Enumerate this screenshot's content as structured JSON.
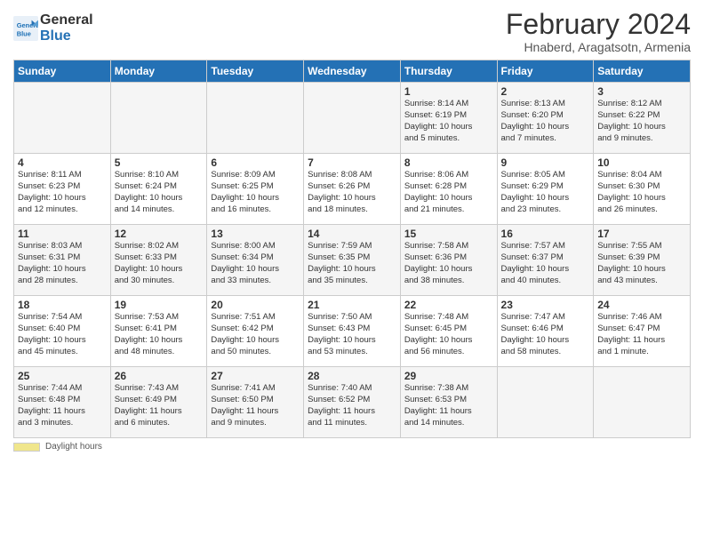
{
  "header": {
    "logo_line1": "General",
    "logo_line2": "Blue",
    "title": "February 2024",
    "subtitle": "Hnaberd, Aragatsotn, Armenia"
  },
  "days_of_week": [
    "Sunday",
    "Monday",
    "Tuesday",
    "Wednesday",
    "Thursday",
    "Friday",
    "Saturday"
  ],
  "weeks": [
    [
      {
        "day": "",
        "info": ""
      },
      {
        "day": "",
        "info": ""
      },
      {
        "day": "",
        "info": ""
      },
      {
        "day": "",
        "info": ""
      },
      {
        "day": "1",
        "info": "Sunrise: 8:14 AM\nSunset: 6:19 PM\nDaylight: 10 hours\nand 5 minutes."
      },
      {
        "day": "2",
        "info": "Sunrise: 8:13 AM\nSunset: 6:20 PM\nDaylight: 10 hours\nand 7 minutes."
      },
      {
        "day": "3",
        "info": "Sunrise: 8:12 AM\nSunset: 6:22 PM\nDaylight: 10 hours\nand 9 minutes."
      }
    ],
    [
      {
        "day": "4",
        "info": "Sunrise: 8:11 AM\nSunset: 6:23 PM\nDaylight: 10 hours\nand 12 minutes."
      },
      {
        "day": "5",
        "info": "Sunrise: 8:10 AM\nSunset: 6:24 PM\nDaylight: 10 hours\nand 14 minutes."
      },
      {
        "day": "6",
        "info": "Sunrise: 8:09 AM\nSunset: 6:25 PM\nDaylight: 10 hours\nand 16 minutes."
      },
      {
        "day": "7",
        "info": "Sunrise: 8:08 AM\nSunset: 6:26 PM\nDaylight: 10 hours\nand 18 minutes."
      },
      {
        "day": "8",
        "info": "Sunrise: 8:06 AM\nSunset: 6:28 PM\nDaylight: 10 hours\nand 21 minutes."
      },
      {
        "day": "9",
        "info": "Sunrise: 8:05 AM\nSunset: 6:29 PM\nDaylight: 10 hours\nand 23 minutes."
      },
      {
        "day": "10",
        "info": "Sunrise: 8:04 AM\nSunset: 6:30 PM\nDaylight: 10 hours\nand 26 minutes."
      }
    ],
    [
      {
        "day": "11",
        "info": "Sunrise: 8:03 AM\nSunset: 6:31 PM\nDaylight: 10 hours\nand 28 minutes."
      },
      {
        "day": "12",
        "info": "Sunrise: 8:02 AM\nSunset: 6:33 PM\nDaylight: 10 hours\nand 30 minutes."
      },
      {
        "day": "13",
        "info": "Sunrise: 8:00 AM\nSunset: 6:34 PM\nDaylight: 10 hours\nand 33 minutes."
      },
      {
        "day": "14",
        "info": "Sunrise: 7:59 AM\nSunset: 6:35 PM\nDaylight: 10 hours\nand 35 minutes."
      },
      {
        "day": "15",
        "info": "Sunrise: 7:58 AM\nSunset: 6:36 PM\nDaylight: 10 hours\nand 38 minutes."
      },
      {
        "day": "16",
        "info": "Sunrise: 7:57 AM\nSunset: 6:37 PM\nDaylight: 10 hours\nand 40 minutes."
      },
      {
        "day": "17",
        "info": "Sunrise: 7:55 AM\nSunset: 6:39 PM\nDaylight: 10 hours\nand 43 minutes."
      }
    ],
    [
      {
        "day": "18",
        "info": "Sunrise: 7:54 AM\nSunset: 6:40 PM\nDaylight: 10 hours\nand 45 minutes."
      },
      {
        "day": "19",
        "info": "Sunrise: 7:53 AM\nSunset: 6:41 PM\nDaylight: 10 hours\nand 48 minutes."
      },
      {
        "day": "20",
        "info": "Sunrise: 7:51 AM\nSunset: 6:42 PM\nDaylight: 10 hours\nand 50 minutes."
      },
      {
        "day": "21",
        "info": "Sunrise: 7:50 AM\nSunset: 6:43 PM\nDaylight: 10 hours\nand 53 minutes."
      },
      {
        "day": "22",
        "info": "Sunrise: 7:48 AM\nSunset: 6:45 PM\nDaylight: 10 hours\nand 56 minutes."
      },
      {
        "day": "23",
        "info": "Sunrise: 7:47 AM\nSunset: 6:46 PM\nDaylight: 10 hours\nand 58 minutes."
      },
      {
        "day": "24",
        "info": "Sunrise: 7:46 AM\nSunset: 6:47 PM\nDaylight: 11 hours\nand 1 minute."
      }
    ],
    [
      {
        "day": "25",
        "info": "Sunrise: 7:44 AM\nSunset: 6:48 PM\nDaylight: 11 hours\nand 3 minutes."
      },
      {
        "day": "26",
        "info": "Sunrise: 7:43 AM\nSunset: 6:49 PM\nDaylight: 11 hours\nand 6 minutes."
      },
      {
        "day": "27",
        "info": "Sunrise: 7:41 AM\nSunset: 6:50 PM\nDaylight: 11 hours\nand 9 minutes."
      },
      {
        "day": "28",
        "info": "Sunrise: 7:40 AM\nSunset: 6:52 PM\nDaylight: 11 hours\nand 11 minutes."
      },
      {
        "day": "29",
        "info": "Sunrise: 7:38 AM\nSunset: 6:53 PM\nDaylight: 11 hours\nand 14 minutes."
      },
      {
        "day": "",
        "info": ""
      },
      {
        "day": "",
        "info": ""
      }
    ]
  ],
  "footer": {
    "daylight_label": "Daylight hours"
  }
}
